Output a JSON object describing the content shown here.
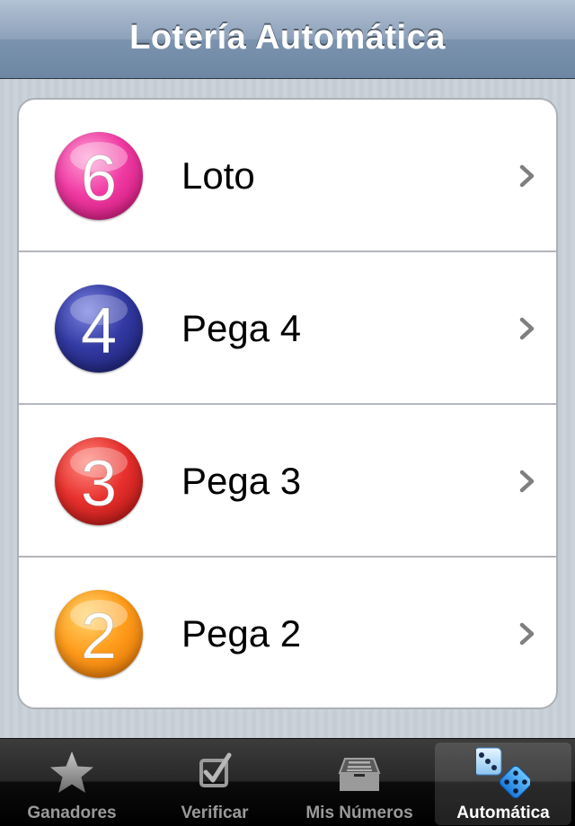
{
  "navbar": {
    "title": "Lotería Automática"
  },
  "list": {
    "items": [
      {
        "number": "6",
        "label": "Loto",
        "ball_color": "#e8318f"
      },
      {
        "number": "4",
        "label": "Pega 4",
        "ball_color": "#2b2f8f"
      },
      {
        "number": "3",
        "label": "Pega 3",
        "ball_color": "#e3302c"
      },
      {
        "number": "2",
        "label": "Pega 2",
        "ball_color": "#ff9418"
      }
    ]
  },
  "tabbar": {
    "tabs": [
      {
        "label": "Ganadores",
        "icon": "star-icon",
        "selected": false
      },
      {
        "label": "Verificar",
        "icon": "checkbox-icon",
        "selected": false
      },
      {
        "label": "Mis Números",
        "icon": "inbox-tray-icon",
        "selected": false
      },
      {
        "label": "Automática",
        "icon": "dice-icon",
        "selected": true
      }
    ]
  }
}
